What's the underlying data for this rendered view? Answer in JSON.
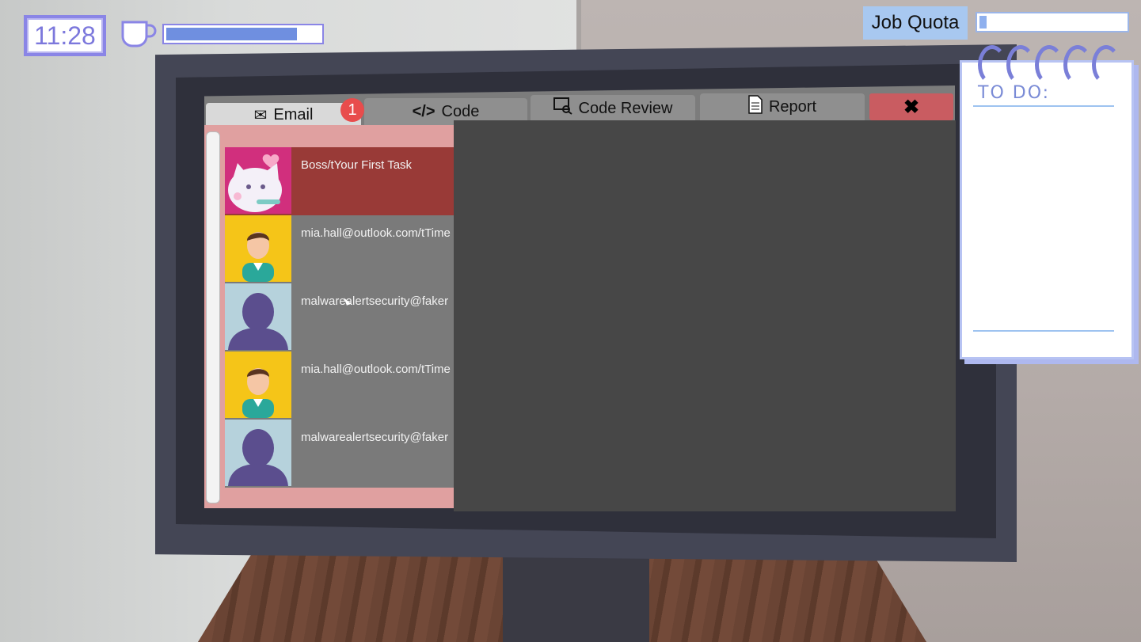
{
  "hud": {
    "clock": "11:28",
    "energy_level": 0.85,
    "job_quota_label": "Job Quota",
    "job_quota_level": 0.05
  },
  "tabs": {
    "email": "Email",
    "email_badge": "1",
    "code": "Code",
    "code_review": "Code Review",
    "report": "Report",
    "close": "✖"
  },
  "emails": [
    {
      "sender": "Boss/tYour First Task",
      "avatar": "cat-avatar",
      "selected": true
    },
    {
      "sender": "mia.hall@outlook.com/tTime",
      "avatar": "person-avatar"
    },
    {
      "sender": "malwarealertsecurity@faker",
      "avatar": "silhouette-avatar"
    },
    {
      "sender": "mia.hall@outlook.com/tTime",
      "avatar": "person-avatar"
    },
    {
      "sender": "malwarealertsecurity@faker",
      "avatar": "silhouette-avatar"
    }
  ],
  "todo": {
    "title": "TO DO:"
  },
  "colors": {
    "accent": "#8a85e6",
    "selected_row": "#993a37",
    "close_button": "#c95c61",
    "badge": "#e84c4c"
  }
}
